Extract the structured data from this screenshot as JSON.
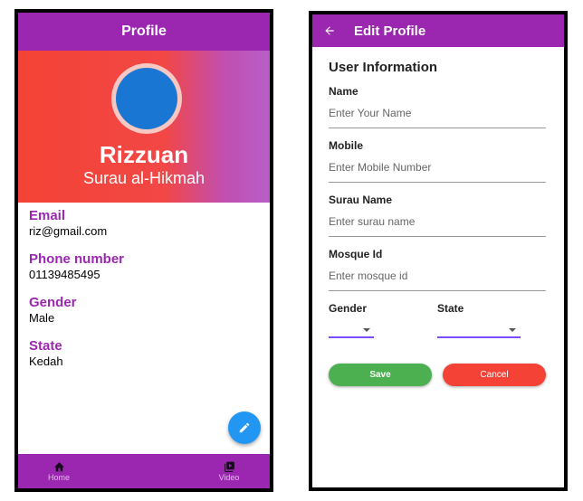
{
  "profile_screen": {
    "title": "Profile",
    "name": "Rizzuan",
    "organization": "Surau al-Hikmah",
    "fields": [
      {
        "label": "Email",
        "value": "riz@gmail.com"
      },
      {
        "label": "Phone number",
        "value": "01139485495"
      },
      {
        "label": "Gender",
        "value": "Male"
      },
      {
        "label": "State",
        "value": "Kedah"
      }
    ],
    "fab_icon": "pencil-icon",
    "bottom_nav": [
      {
        "label": "Home",
        "icon": "home-icon"
      },
      {
        "label": "Video",
        "icon": "video-library-icon"
      }
    ]
  },
  "edit_screen": {
    "title": "Edit Profile",
    "back_icon": "arrow-left-icon",
    "section_title": "User Information",
    "fields": [
      {
        "label": "Name",
        "placeholder": "Enter Your Name"
      },
      {
        "label": "Mobile",
        "placeholder": "Enter Mobile Number"
      },
      {
        "label": "Surau Name",
        "placeholder": "Enter surau name"
      },
      {
        "label": "Mosque Id",
        "placeholder": "Enter mosque id"
      }
    ],
    "dropdowns": [
      {
        "label": "Gender",
        "value": ""
      },
      {
        "label": "State",
        "value": ""
      }
    ],
    "save_label": "Save",
    "cancel_label": "Cancel"
  },
  "colors": {
    "primary": "#9b27b0",
    "header_red": "#f44336",
    "avatar_blue": "#1976d2",
    "fab_blue": "#2196f3",
    "save_green": "#4caf50",
    "cancel_red": "#f44336",
    "underline_accent": "#7c4dff"
  }
}
